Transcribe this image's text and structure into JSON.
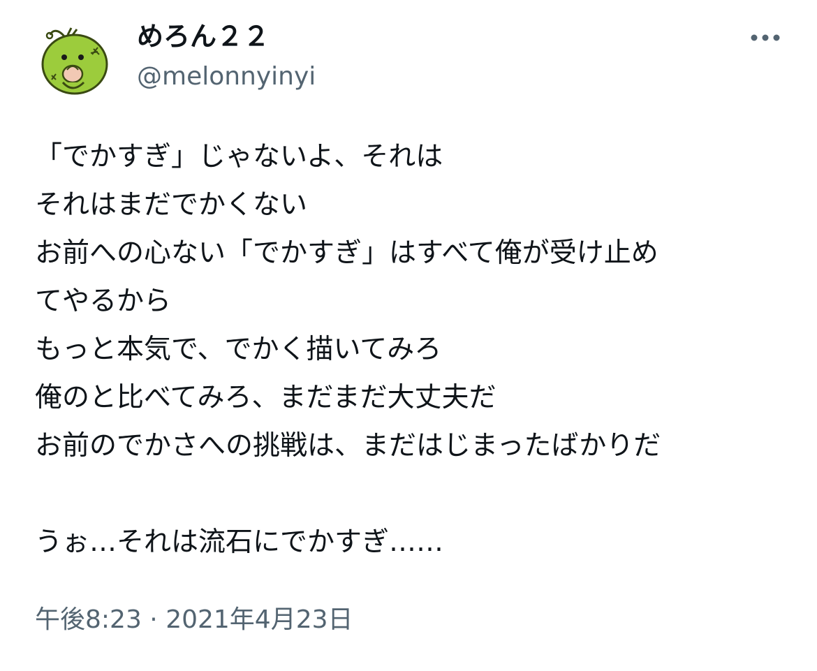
{
  "author": {
    "display_name": "めろん２２",
    "handle": "@melonnyinyi",
    "avatar_icon": "melon-character-avatar"
  },
  "more_icon": "more-horizontal-icon",
  "tweet": {
    "lines": [
      "「でかすぎ」じゃないよ、それは",
      "それはまだでかくない",
      "お前への心ない「でかすぎ」はすべて俺が受け止め",
      "てやるから",
      "もっと本気で、でかく描いてみろ",
      "俺のと比べてみろ、まだまだ大丈夫だ",
      "お前のでかさへの挑戦は、まだはじまったばかりだ",
      "",
      "うぉ…それは流石にでかすぎ……"
    ],
    "time": "午後8:23",
    "separator": " · ",
    "date": "2021年4月23日"
  },
  "colors": {
    "text": "#0f1419",
    "secondary": "#536471",
    "avatar_green": "#9ccc3c"
  }
}
